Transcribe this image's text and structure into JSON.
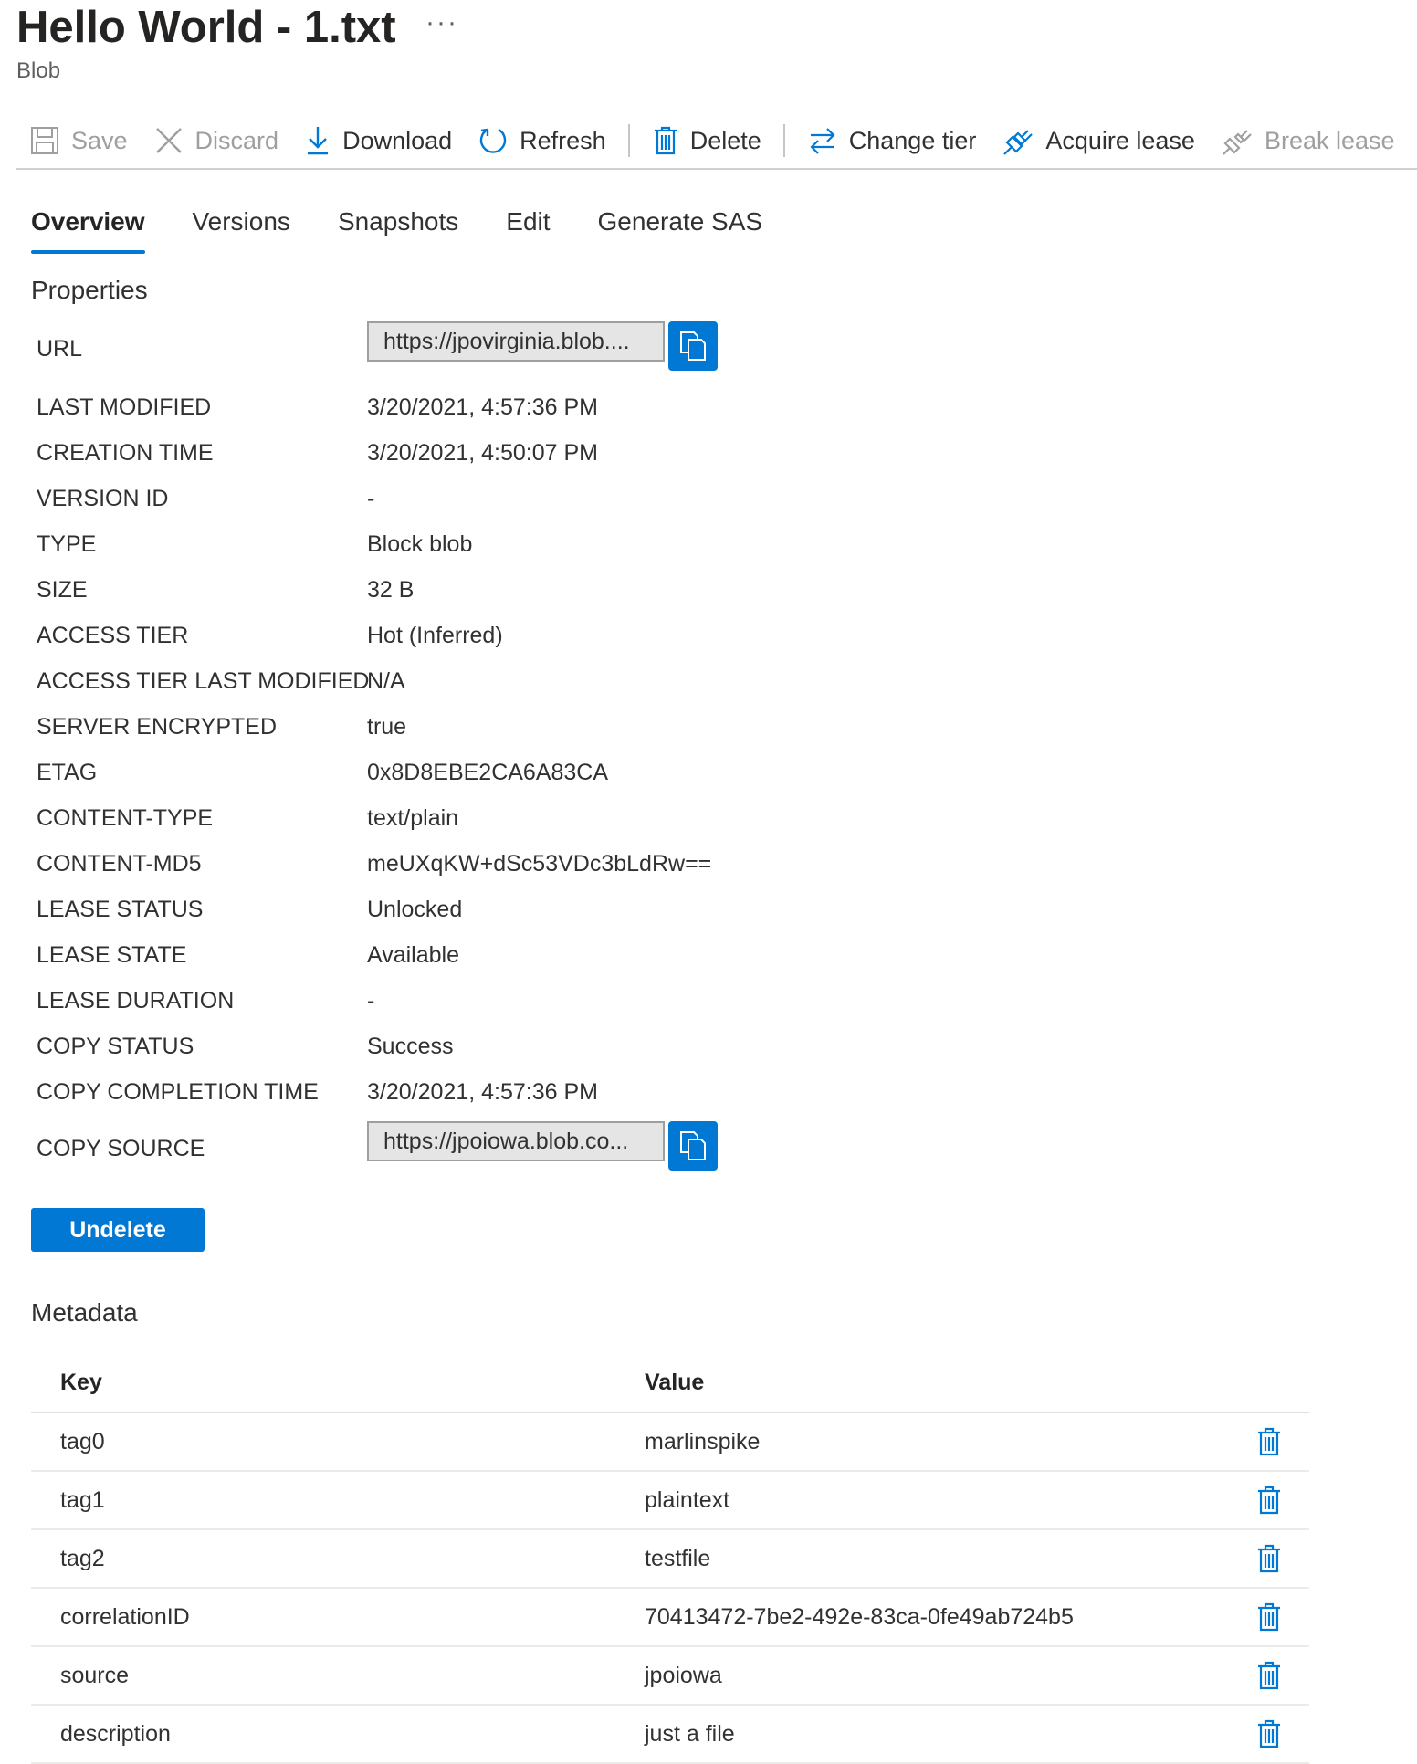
{
  "header": {
    "title": "Hello World - 1.txt",
    "more": "···",
    "subtitle": "Blob"
  },
  "toolbar": {
    "save": "Save",
    "discard": "Discard",
    "download": "Download",
    "refresh": "Refresh",
    "delete": "Delete",
    "change_tier": "Change tier",
    "acquire_lease": "Acquire lease",
    "break_lease": "Break lease"
  },
  "tabs": [
    {
      "label": "Overview"
    },
    {
      "label": "Versions"
    },
    {
      "label": "Snapshots"
    },
    {
      "label": "Edit"
    },
    {
      "label": "Generate SAS"
    }
  ],
  "properties": {
    "title": "Properties",
    "url": {
      "label": "URL",
      "value": "https://jpovirginia.blob...."
    },
    "items": [
      {
        "label": "LAST MODIFIED",
        "value": "3/20/2021, 4:57:36 PM"
      },
      {
        "label": "CREATION TIME",
        "value": "3/20/2021, 4:50:07 PM"
      },
      {
        "label": "VERSION ID",
        "value": "-"
      },
      {
        "label": "TYPE",
        "value": "Block blob"
      },
      {
        "label": "SIZE",
        "value": "32 B"
      },
      {
        "label": "ACCESS TIER",
        "value": "Hot (Inferred)"
      },
      {
        "label": "ACCESS TIER LAST MODIFIED",
        "value": "N/A"
      },
      {
        "label": "SERVER ENCRYPTED",
        "value": "true"
      },
      {
        "label": "ETAG",
        "value": "0x8D8EBE2CA6A83CA"
      },
      {
        "label": "CONTENT-TYPE",
        "value": "text/plain"
      },
      {
        "label": "CONTENT-MD5",
        "value": "meUXqKW+dSc53VDc3bLdRw=="
      },
      {
        "label": "LEASE STATUS",
        "value": "Unlocked"
      },
      {
        "label": "LEASE STATE",
        "value": "Available"
      },
      {
        "label": "LEASE DURATION",
        "value": "-"
      },
      {
        "label": "COPY STATUS",
        "value": "Success"
      },
      {
        "label": "COPY COMPLETION TIME",
        "value": "3/20/2021, 4:57:36 PM"
      }
    ],
    "copy_source": {
      "label": "COPY SOURCE",
      "value": "https://jpoiowa.blob.co..."
    }
  },
  "undelete_label": "Undelete",
  "metadata": {
    "title": "Metadata",
    "columns": {
      "key": "Key",
      "value": "Value"
    },
    "rows": [
      {
        "key": "tag0",
        "value": "marlinspike"
      },
      {
        "key": "tag1",
        "value": "plaintext"
      },
      {
        "key": "tag2",
        "value": "testfile"
      },
      {
        "key": "correlationID",
        "value": "70413472-7be2-492e-83ca-0fe49ab724b5"
      },
      {
        "key": "source",
        "value": "jpoiowa"
      },
      {
        "key": "description",
        "value": "just a file"
      }
    ]
  },
  "colors": {
    "accent": "#0078d4",
    "disabled_text": "#a19f9d",
    "text": "#323130"
  }
}
